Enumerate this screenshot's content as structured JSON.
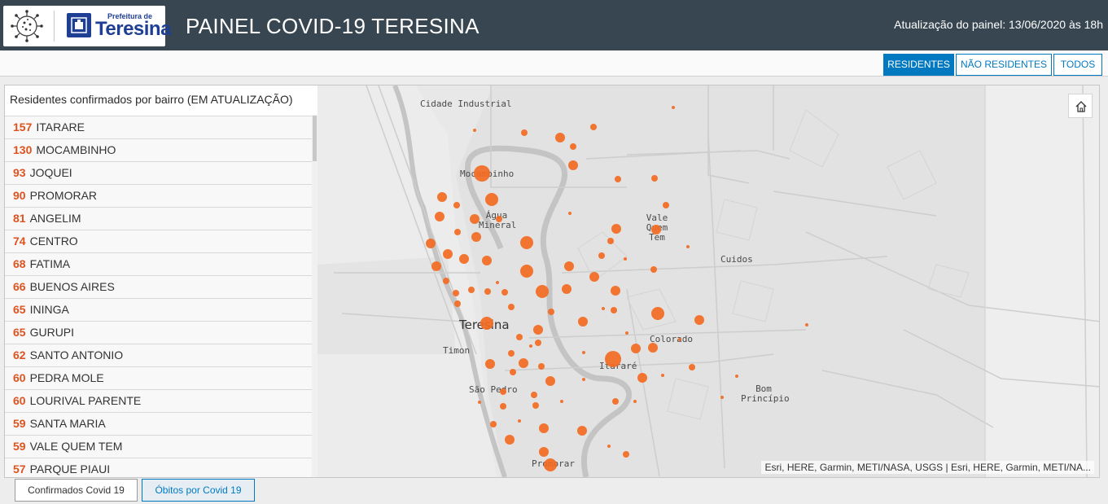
{
  "header": {
    "logo_small_text": "Prefeitura de",
    "logo_name": "Teresina",
    "title": "PAINEL COVID-19 TERESINA",
    "update_text": "Atualização do painel: 13/06/2020 às 18h"
  },
  "tabs": [
    {
      "label": "RESIDENTES",
      "active": true
    },
    {
      "label": "NÃO RESIDENTES",
      "active": false
    },
    {
      "label": "TODOS",
      "active": false
    }
  ],
  "list": {
    "title": "Residentes confirmados por bairro (EM ATUALIZAÇÃO)",
    "items": [
      {
        "count": "157",
        "name": "ITARARE"
      },
      {
        "count": "130",
        "name": "MOCAMBINHO"
      },
      {
        "count": "93",
        "name": "JOQUEI"
      },
      {
        "count": "90",
        "name": "PROMORAR"
      },
      {
        "count": "81",
        "name": "ANGELIM"
      },
      {
        "count": "74",
        "name": "CENTRO"
      },
      {
        "count": "68",
        "name": "FATIMA"
      },
      {
        "count": "66",
        "name": "BUENOS AIRES"
      },
      {
        "count": "65",
        "name": "ININGA"
      },
      {
        "count": "65",
        "name": "GURUPI"
      },
      {
        "count": "62",
        "name": "SANTO ANTONIO"
      },
      {
        "count": "60",
        "name": "PEDRA MOLE"
      },
      {
        "count": "60",
        "name": "LOURIVAL PARENTE"
      },
      {
        "count": "59",
        "name": "SANTA MARIA"
      },
      {
        "count": "59",
        "name": "VALE QUEM TEM"
      },
      {
        "count": "57",
        "name": "PARQUE PIAUI"
      }
    ]
  },
  "map": {
    "places": {
      "cidade_industrial": "Cidade Industrial",
      "mocambinho": "Mocambinho",
      "agua_mineral": "Água Mineral",
      "vale_quem_tem": "Vale Quem Tem",
      "cuidos": "Cuidos",
      "teresina": "Teresina",
      "timon": "Timon",
      "colorado": "Colorado",
      "itarare": "Itararé",
      "sao_pedro": "São Pedro",
      "bom_principio": "Bom Princípio",
      "promorar": "Promorar"
    },
    "attribution": "Esri, HERE, Garmin, METI/NASA, USGS | Esri, HERE, Garmin, METI/NA...",
    "marker_color": "#f26a21",
    "home_icon": "home-icon"
  },
  "bottom_tabs": [
    {
      "label": "Confirmados Covid 19",
      "active": true
    },
    {
      "label": "Óbitos por Covid 19",
      "active": false
    }
  ]
}
